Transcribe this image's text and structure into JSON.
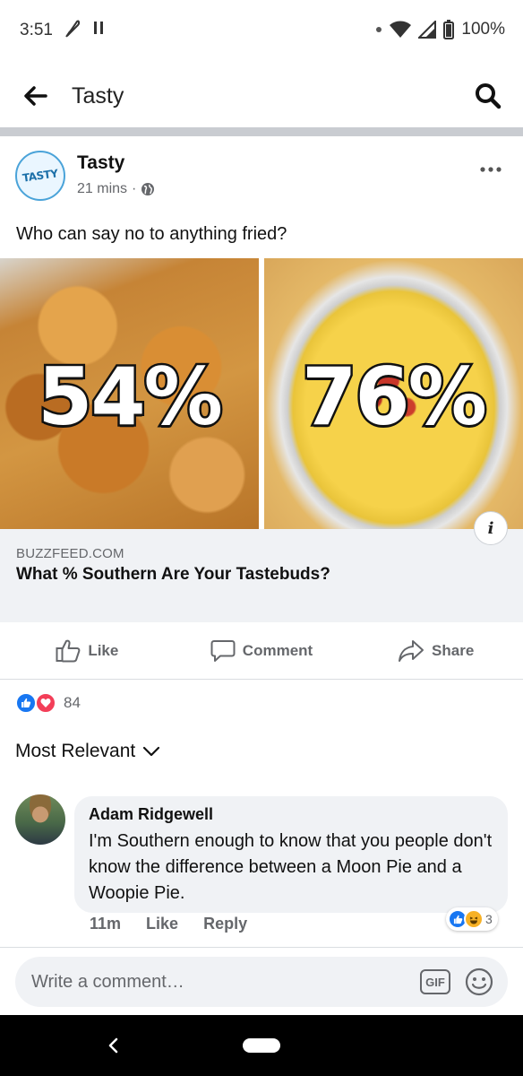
{
  "status_bar": {
    "time": "3:51",
    "battery": "100%",
    "icons": [
      "feather-icon",
      "pause-icon",
      "dot-icon",
      "wifi-icon",
      "signal-icon",
      "battery-icon"
    ]
  },
  "app_bar": {
    "title": "Tasty",
    "icons": [
      "back-arrow-icon",
      "search-icon"
    ]
  },
  "post": {
    "author": "Tasty",
    "avatar_text": "TASTY",
    "time": "21 mins",
    "separator": "·",
    "privacy_icon": "globe-icon",
    "text": "Who can say no to anything fried?",
    "images": [
      {
        "label": "54%",
        "subject": "fried chicken"
      },
      {
        "label": "76%",
        "subject": "queso dip"
      }
    ],
    "link": {
      "domain": "BUZZFEED.COM",
      "title": "What % Southern Are Your Tastebuds?"
    },
    "actions": {
      "like": "Like",
      "comment": "Comment",
      "share": "Share"
    },
    "reactions": {
      "types": [
        "like-icon",
        "love-icon"
      ],
      "count": "84"
    }
  },
  "comments": {
    "sort_label": "Most Relevant",
    "items": [
      {
        "author": "Adam Ridgewell",
        "text": "I'm Southern enough to know that you people don't know the difference between a Moon Pie and a Woopie Pie.",
        "time": "11m",
        "like": "Like",
        "reply": "Reply",
        "reaction_count": "3",
        "reaction_types": [
          "like-icon",
          "haha-icon"
        ]
      }
    ],
    "composer_placeholder": "Write a comment…",
    "gif_label": "GIF"
  },
  "colors": {
    "facebook_blue": "#1877f2",
    "love_red": "#f33e58",
    "haha_yellow": "#f7b125",
    "secondary_text": "#65676b"
  }
}
